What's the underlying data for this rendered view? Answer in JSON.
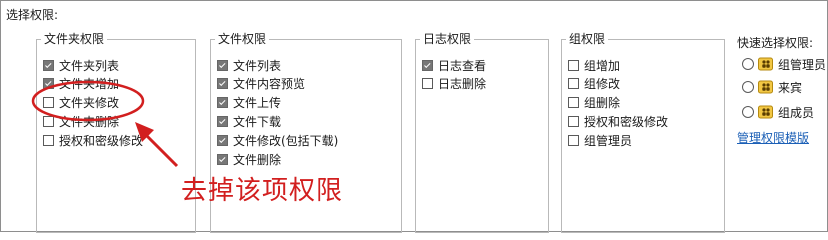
{
  "window": {
    "title": "选择权限:"
  },
  "groups": {
    "folder": {
      "legend": "文件夹权限",
      "items": [
        {
          "label": "文件夹列表",
          "checked": true
        },
        {
          "label": "文件夹增加",
          "checked": true
        },
        {
          "label": "文件夹修改",
          "checked": false
        },
        {
          "label": "文件夹删除",
          "checked": false
        },
        {
          "label": "授权和密级修改",
          "checked": false
        }
      ]
    },
    "file": {
      "legend": "文件权限",
      "items": [
        {
          "label": "文件列表",
          "checked": true
        },
        {
          "label": "文件内容预览",
          "checked": true
        },
        {
          "label": "文件上传",
          "checked": true
        },
        {
          "label": "文件下载",
          "checked": true
        },
        {
          "label": "文件修改(包括下载)",
          "checked": true
        },
        {
          "label": "文件删除",
          "checked": true
        }
      ]
    },
    "log": {
      "legend": "日志权限",
      "items": [
        {
          "label": "日志查看",
          "checked": true
        },
        {
          "label": "日志删除",
          "checked": false
        }
      ]
    },
    "grp": {
      "legend": "组权限",
      "items": [
        {
          "label": "组增加",
          "checked": false
        },
        {
          "label": "组修改",
          "checked": false
        },
        {
          "label": "组删除",
          "checked": false
        },
        {
          "label": "授权和密级修改",
          "checked": false
        },
        {
          "label": "组管理员",
          "checked": false
        }
      ]
    }
  },
  "quick_select": {
    "title": "快速选择权限:",
    "options": [
      {
        "label": "组管理员",
        "icon": "role-group-icon"
      },
      {
        "label": "来宾",
        "icon": "role-group-icon"
      },
      {
        "label": "组成员",
        "icon": "role-group-icon"
      }
    ],
    "manage_link": "管理权限模版"
  },
  "annotation": {
    "text": "去掉该项权限",
    "color": "#d21f1f"
  }
}
